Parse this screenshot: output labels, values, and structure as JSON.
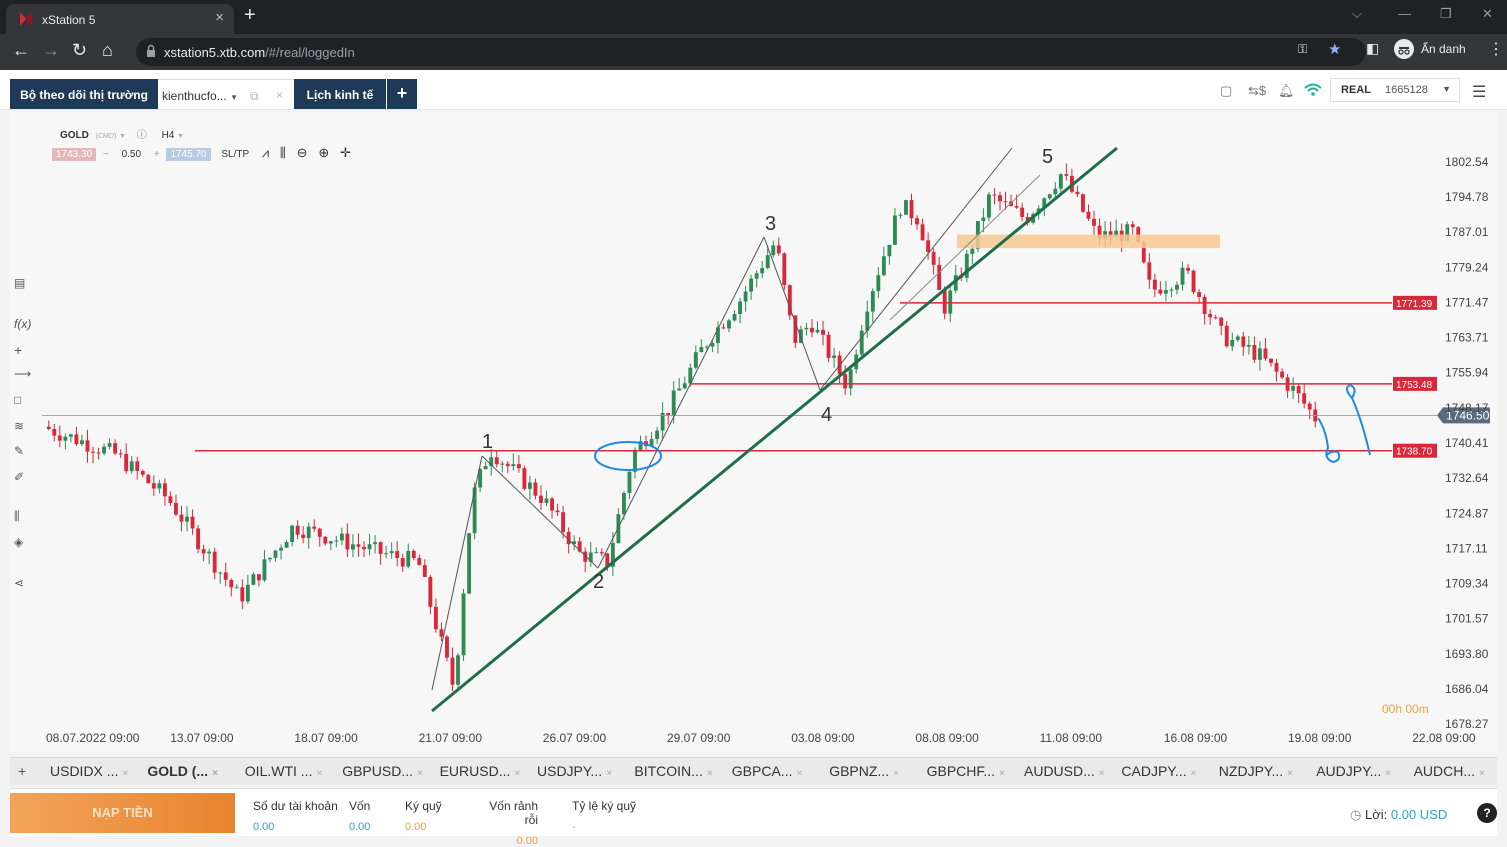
{
  "browser": {
    "tab_title": "xStation 5",
    "url_host": "xstation5.xtb.com",
    "url_path": "/#/real/loggedIn",
    "incognito_label": "Ẩn danh"
  },
  "app": {
    "tabs": [
      {
        "label": "Bộ theo dõi thị trường"
      },
      {
        "label": "kienthucfo..."
      },
      {
        "label": "Lịch kinh tế"
      }
    ],
    "account": {
      "type": "REAL",
      "number": "1665128"
    }
  },
  "chart_header": {
    "symbol": "GOLD",
    "source": "(CMD)",
    "timeframe": "H4",
    "bid": "1743.30",
    "volume": "0.50",
    "ask": "1745.70",
    "sltp": "SL/TP"
  },
  "chart_data": {
    "type": "candlestick",
    "symbol": "GOLD",
    "timeframe": "H4",
    "y_ticks": [
      1802.54,
      1794.78,
      1787.01,
      1779.24,
      1771.47,
      1763.71,
      1755.94,
      1748.17,
      1740.41,
      1732.64,
      1724.87,
      1717.11,
      1709.34,
      1701.57,
      1693.8,
      1686.04,
      1678.27
    ],
    "y_tick_labels": [
      "1802.54",
      "1794.78",
      "1787.01",
      "1779.24",
      "1771.47",
      "1763.71",
      "1755.94",
      "1748.17",
      "1740.41",
      "1732.64",
      "1724.87",
      "1717.11",
      "1709.34",
      "1701.57",
      "1693.80",
      "1686.04",
      "1678.27"
    ],
    "x_labels": [
      "08.07.2022 09:00",
      "13.07 09:00",
      "18.07 09:00",
      "21.07 09:00",
      "26.07 09:00",
      "29.07 09:00",
      "03.08 09:00",
      "08.08 09:00",
      "11.08 09:00",
      "16.08 09:00",
      "19.08 09:00",
      "22.08 09:00"
    ],
    "current_price": 1746.5,
    "current_price_label": "1746.50",
    "levels": [
      {
        "price": 1771.39,
        "label": "1771.39"
      },
      {
        "price": 1753.48,
        "label": "1753.48"
      },
      {
        "price": 1738.7,
        "label": "1738.70"
      }
    ],
    "wave_labels": [
      "1",
      "2",
      "3",
      "4",
      "5"
    ],
    "countdown": "00h 00m",
    "colors": {
      "bull": "#2e8b57",
      "bear": "#d9283a",
      "trend": "#1f6e4a",
      "level": "#d9283a",
      "zone": "#f7c993",
      "annotation": "#1e88e5"
    }
  },
  "market_tabs": [
    "USDIDX ...",
    "GOLD (...",
    "OIL.WTI ...",
    "GBPUSD...",
    "EURUSD...",
    "USDJPY...",
    "BITCOIN...",
    "GBPCA...",
    "GBPNZ...",
    "GBPCHF...",
    "AUDUSD...",
    "CADJPY...",
    "NZDJPY...",
    "AUDJPY...",
    "AUDCH..."
  ],
  "footer": {
    "deposit": "NẠP TIỀN",
    "balance_label": "Số dư tài khoản",
    "balance": "0.00",
    "equity_label": "Vốn",
    "equity": "0.00",
    "margin_label": "Ký quỹ",
    "margin": "0.00",
    "free_margin_label": "Vốn rảnh rỗi",
    "free_margin": "0.00",
    "margin_level_label": "Tỷ lệ ký quỹ",
    "margin_level": "-",
    "profit_label": "Lời:",
    "profit": "0.00 USD"
  }
}
